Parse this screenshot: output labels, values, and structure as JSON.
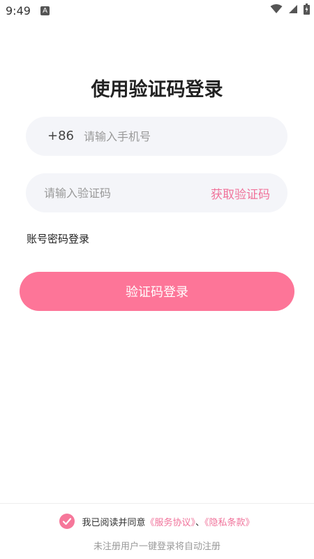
{
  "status_bar": {
    "time": "9:49",
    "notification_letter": "A",
    "icons": [
      "wifi-icon",
      "signal-icon",
      "battery-icon"
    ]
  },
  "title": "使用验证码登录",
  "phone_field": {
    "prefix": "+86",
    "placeholder": "请输入手机号",
    "value": ""
  },
  "code_field": {
    "placeholder": "请输入验证码",
    "value": "",
    "get_code_label": "获取验证码"
  },
  "account_login_link": "账号密码登录",
  "login_button": "验证码登录",
  "footer": {
    "agree_checked": true,
    "agree_prefix": "我已阅读并同意",
    "service_agreement": "《服务协议》",
    "separator": "、",
    "privacy_policy": "《隐私条款》",
    "auto_register_note": "未注册用户一键登录将自动注册"
  },
  "colors": {
    "accent": "#f0729a",
    "button": "#fd7598",
    "field_bg": "#f4f5f9"
  }
}
